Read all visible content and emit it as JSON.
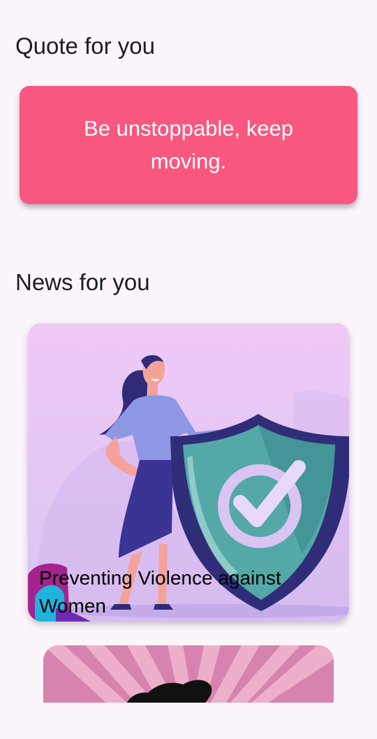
{
  "quote_section": {
    "heading": "Quote for you",
    "quote": "Be unstoppable, keep moving."
  },
  "news_section": {
    "heading": "News for you",
    "items": [
      {
        "title": "Preventing Violence against Women"
      }
    ]
  },
  "colors": {
    "background": "#fdf5fc",
    "quote_card": "#f8587f",
    "heading_text": "#1c1b1f"
  },
  "icons": [
    "woman-with-shield-illustration",
    "check-mark-icon",
    "woman-silhouette-icon"
  ]
}
